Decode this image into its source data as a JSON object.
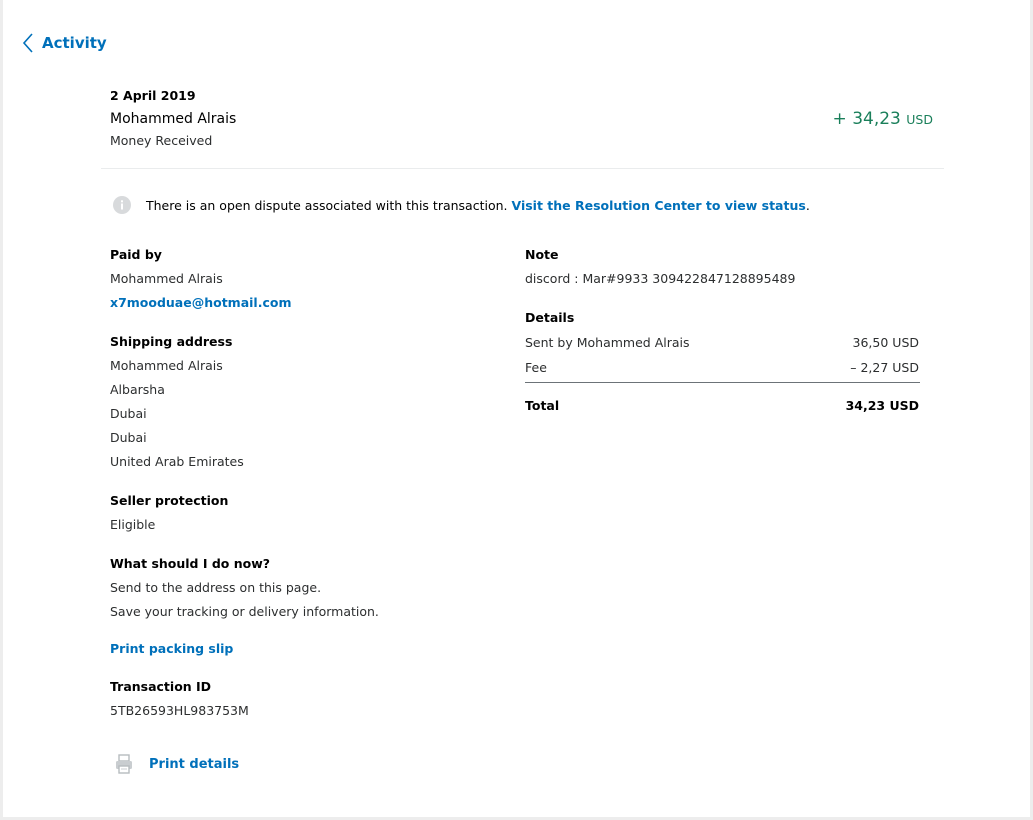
{
  "header": {
    "back_label": "Activity"
  },
  "transaction": {
    "date": "2 April 2019",
    "name": "Mohammed Alrais",
    "type": "Money Received",
    "amount": "+ 34,23",
    "currency": "USD",
    "amount_color": "#1a7f5a"
  },
  "notice": {
    "text": "There is an open dispute associated with this transaction.",
    "link": "Visit the Resolution Center to view status",
    "suffix": "."
  },
  "paid_by": {
    "label": "Paid by",
    "name": "Mohammed Alrais",
    "email": "x7mooduae@hotmail.com"
  },
  "shipping": {
    "label": "Shipping address",
    "lines": [
      "Mohammed Alrais",
      "Albarsha",
      "Dubai",
      "Dubai",
      "United Arab Emirates"
    ]
  },
  "seller_protection": {
    "label": "Seller protection",
    "value": "Eligible"
  },
  "what_now": {
    "label": "What should I do now?",
    "lines": [
      "Send to the address on this page.",
      "Save your tracking or delivery information."
    ]
  },
  "packing_slip": {
    "label": "Print packing slip"
  },
  "transaction_id": {
    "label": "Transaction ID",
    "value": "5TB26593HL983753M"
  },
  "note": {
    "label": "Note",
    "value": "discord : Mar#9933 309422847128895489"
  },
  "details": {
    "label": "Details",
    "rows": [
      {
        "label": "Sent by Mohammed Alrais",
        "value": "36,50 USD"
      },
      {
        "label": "Fee",
        "value": "– 2,27 USD"
      }
    ],
    "total_label": "Total",
    "total_value": "34,23 USD"
  },
  "print": {
    "label": "Print details",
    "icon": "printer-icon"
  },
  "colors": {
    "link": "#0070ba",
    "positive": "#1a7f5a"
  }
}
